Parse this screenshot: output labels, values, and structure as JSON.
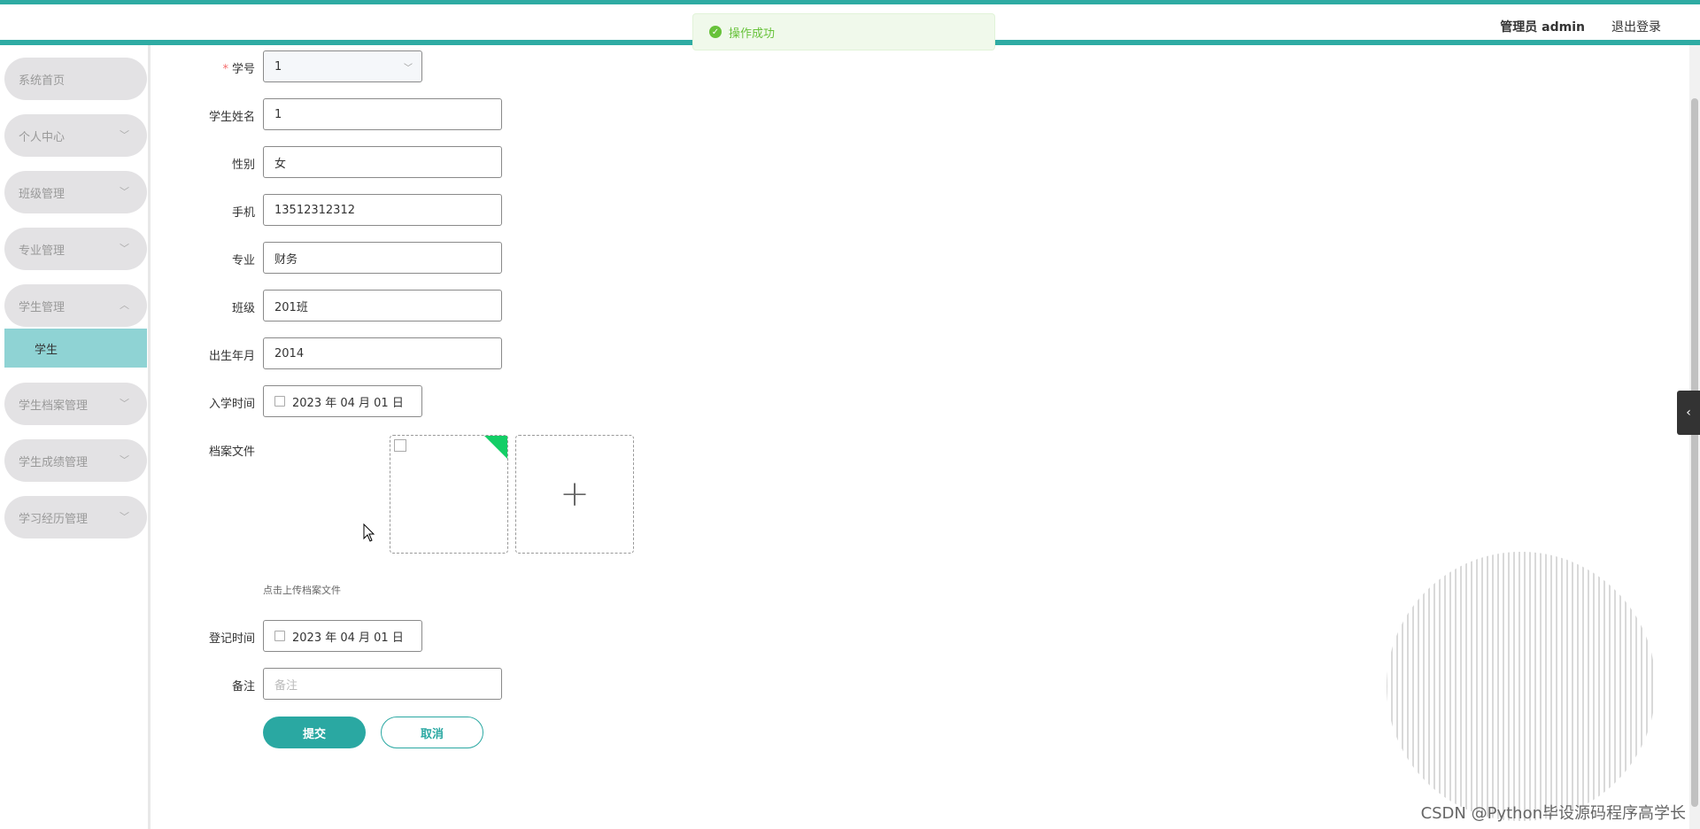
{
  "header": {
    "user_label": "管理员 admin",
    "logout_label": "退出登录"
  },
  "toast": {
    "message": "操作成功",
    "color": "#67c23a"
  },
  "sidebar": {
    "items": [
      {
        "label": "系统首页"
      },
      {
        "label": "个人中心"
      },
      {
        "label": "班级管理"
      },
      {
        "label": "专业管理"
      },
      {
        "label": "学生管理"
      },
      {
        "label": "学生档案管理"
      },
      {
        "label": "学生成绩管理"
      },
      {
        "label": "学习经历管理"
      }
    ],
    "active_sub": "学生"
  },
  "form": {
    "student_no": {
      "label": "学号",
      "value": "1"
    },
    "student_name": {
      "label": "学生姓名",
      "value": "1"
    },
    "gender": {
      "label": "性别",
      "value": "女"
    },
    "phone": {
      "label": "手机",
      "value": "13512312312"
    },
    "major": {
      "label": "专业",
      "value": "财务"
    },
    "class": {
      "label": "班级",
      "value": "201班"
    },
    "birth": {
      "label": "出生年月",
      "value": "2014"
    },
    "enroll_date": {
      "label": "入学时间",
      "value": "2023 年 04 月 01 日"
    },
    "file": {
      "label": "档案文件",
      "hint": "点击上传档案文件"
    },
    "register_date": {
      "label": "登记时间",
      "value": "2023 年 04 月 01 日"
    },
    "remark": {
      "label": "备注",
      "placeholder": "备注"
    },
    "submit_label": "提交",
    "cancel_label": "取消"
  },
  "watermark": "CSDN @Python毕设源码程序高学长",
  "colors": {
    "accent": "#2eaba3",
    "menu_bg": "#e3e2e4",
    "submenu_active": "#8fd3d4"
  }
}
